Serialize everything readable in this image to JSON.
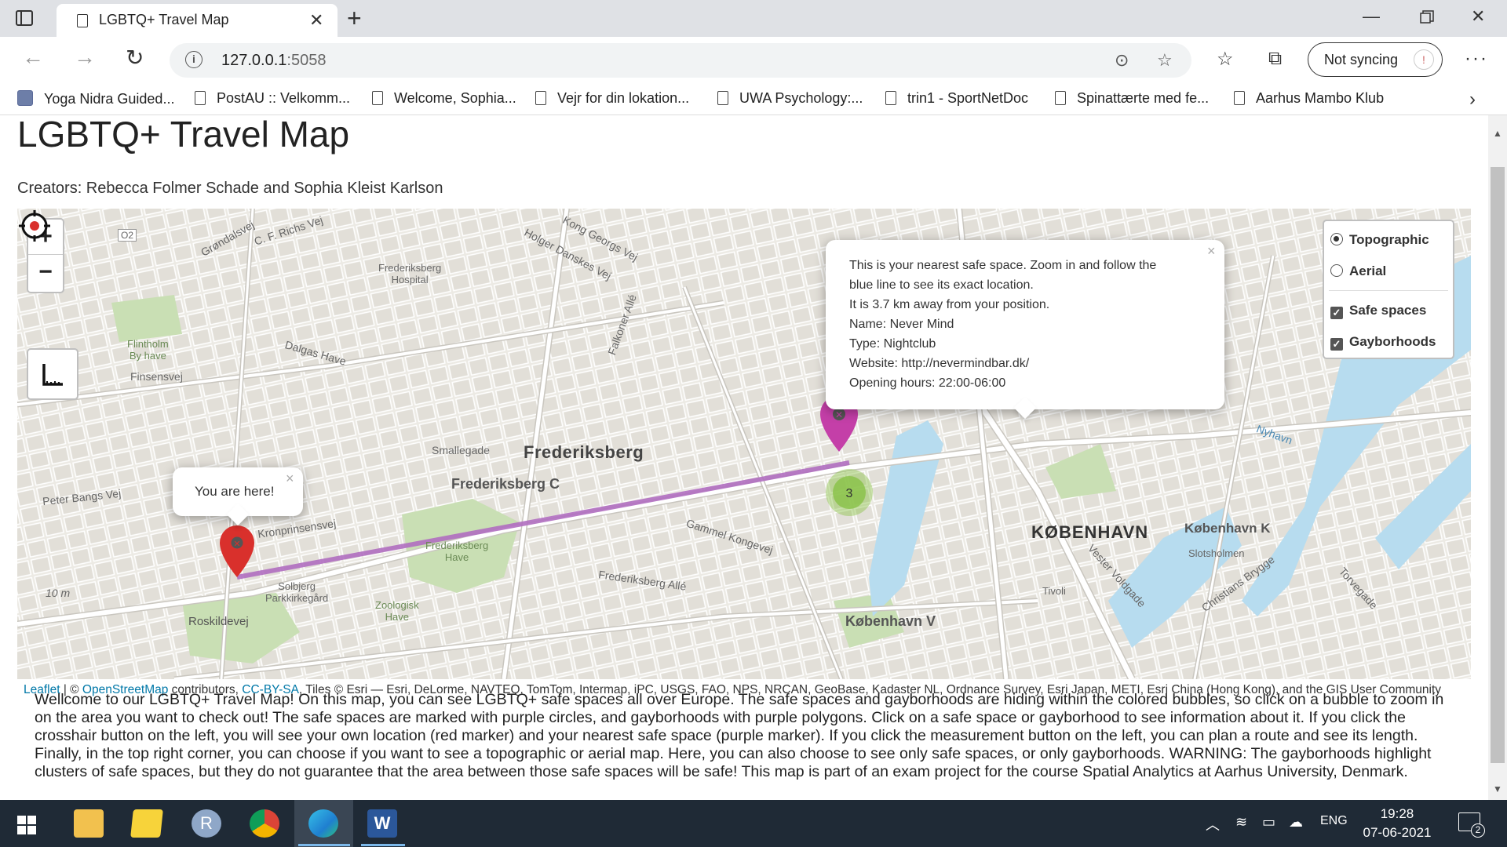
{
  "browser": {
    "tab_title": "LGBTQ+ Travel Map",
    "url_host": "127.0.0.1",
    "url_port": ":5058",
    "sync_label": "Not syncing",
    "bookmarks": [
      "Yoga Nidra Guided...",
      "PostAU :: Velkomm...",
      "Welcome, Sophia...",
      "Vejr for din lokation...",
      "UWA Psychology:...",
      "trin1 - SportNetDoc",
      "Spinattærte med fe...",
      "Aarhus Mambo Klub"
    ]
  },
  "page": {
    "title": "LGBTQ+ Travel Map",
    "creators": "Creators: Rebecca Folmer Schade and Sophia Kleist Karlson",
    "intro": "Wellcome to our LGBTQ+ Travel Map! On this map, you can see LGBTQ+ safe spaces all over Europe. The safe spaces and gayborhoods are hiding within the colored bubbles, so click on a bubble to zoom in on the area you want to check out! The safe spaces are marked with purple circles, and gayborhoods with purple polygons. Click on a safe space or gayborhood to see information about it. If you click the crosshair button on the left, you will see your own location (red marker) and your nearest safe space (purple marker). If you click the measurement button on the left, you can plan a route and see its length. Finally, in the top right corner, you can choose if you want to see a topographic or aerial map. Here, you can also choose to see only safe spaces, or only gayborhoods. WARNING: The gayborhoods highlight clusters of safe spaces, but they do not guarantee that the area between those safe spaces will be safe! This map is part of an exam project for the course Spatial Analytics at Aarhus University, Denmark."
  },
  "map": {
    "zoom_in": "+",
    "zoom_out": "−",
    "layers": {
      "base": [
        {
          "label": "Topographic",
          "selected": true
        },
        {
          "label": "Aerial",
          "selected": false
        }
      ],
      "overlays": [
        {
          "label": "Safe spaces",
          "checked": true
        },
        {
          "label": "Gayborhoods",
          "checked": true
        }
      ]
    },
    "user_popup": "You are here!",
    "nearest_popup": [
      "This is your nearest safe space. Zoom in and follow the",
      "blue line to see its exact location.",
      "It is 3.7 km away from your position.",
      "Name: Never Mind",
      "Type: Nightclub",
      "Website: http://nevermindbar.dk/",
      "Opening hours: 22:00-06:00"
    ],
    "cluster_count": "3",
    "popup_close": "×",
    "attribution": {
      "leaflet": "Leaflet",
      "osm": "OpenStreetMap",
      "license": "CC-BY-SA",
      "sep1": " | © ",
      "contrib": " contributors, ",
      "tiles": ", Tiles © Esri — Esri, DeLorme, NAVTEQ, TomTom, Intermap, iPC, USGS, FAO, NPS, NRCAN, GeoBase, Kadaster NL, Ordnance Survey, Esri Japan, METI, Esri China (Hong Kong), and the GIS User Community"
    },
    "labels": {
      "frederiksberg": "Frederiksberg",
      "frederiksberg_c": "Frederiksberg C",
      "kobenhavn": "KØBENHAVN",
      "kobenhavn_v": "København V",
      "kobenhavn_k": "København K",
      "fred_hospital": "Frederiksberg\nHospital",
      "flintholm": "Flintholm\nBy have",
      "fred_have": "Frederiksberg\nHave",
      "solbjerg": "Solbjerg\nParkkirkegård",
      "zoologisk": "Zoologisk\nHave",
      "tivoli": "Tivoli",
      "slotsholmen": "Slotsholmen",
      "roskildevej": "Roskildevej",
      "peter_bangs": "Peter Bangs Vej",
      "kronprinsensvej": "Kronprinsensvej",
      "smallegade": "Smallegade",
      "dalgas": "Dalgas Have",
      "finsensvej": "Finsensvej",
      "gammel_kongevej": "Gammel Kongevej",
      "frederiksberg_alle": "Frederiksberg Allé",
      "falkoner": "Falkoner Allé",
      "kong_georgs": "Kong Georgs Vej",
      "holger_danskes": "Holger Danskes Vej",
      "grondalsvej": "Grøndalsvej",
      "richs_vej": "C. F. Richs Vej",
      "christians_brygge": "Christians Brygge",
      "vester_voldgade": "Vester Voldgade",
      "nyhavn": "Nyhavn",
      "torvegade": "Torvegade",
      "ten_m": "10 m",
      "o2": "O2"
    }
  },
  "taskbar": {
    "lang": "ENG",
    "time": "19:28",
    "date": "07-06-2021",
    "notif_count": "2"
  },
  "colors": {
    "route": "#b06ec0",
    "user_marker": "#d9302c",
    "safe_marker": "#c43fa8",
    "cluster": "#8bc34a",
    "water": "#b7dcef",
    "park": "#c9dfb4"
  }
}
